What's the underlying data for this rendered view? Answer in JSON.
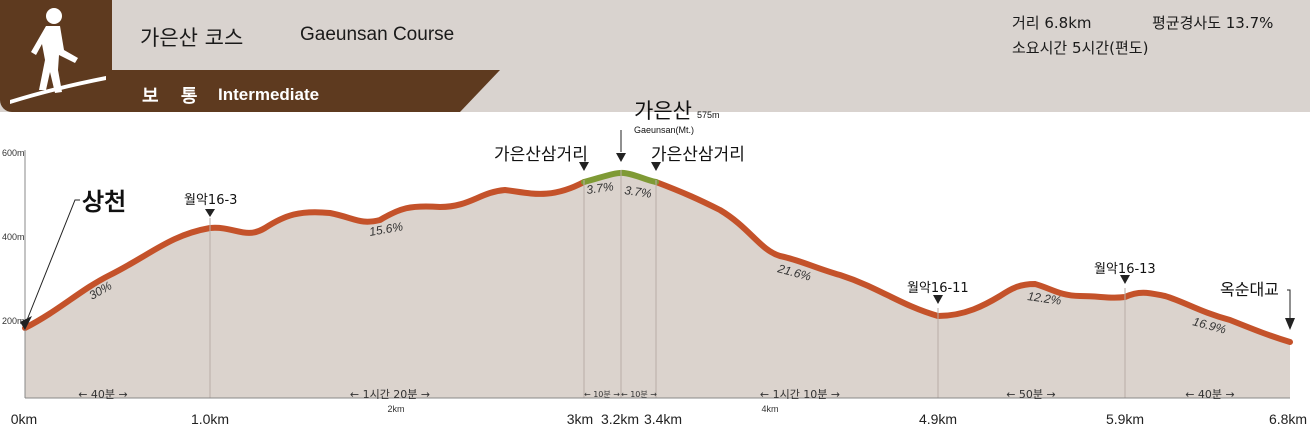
{
  "header": {
    "course_name_ko": "가은산 코스",
    "course_name_en": "Gaeunsan Course",
    "distance": "거리 6.8km",
    "avg_slope": "평균경사도 13.7%",
    "duration": "소요시간 5시간(편도)",
    "difficulty_ko": "보 통",
    "difficulty_en": "Intermediate",
    "icon": "hiker-icon"
  },
  "colors": {
    "brown": "#5e3a1f",
    "trail": "#c4522a",
    "summit_trail": "#7f9a35",
    "area_fill": "#dbd3cd",
    "header_bg": "#d9d3cf"
  },
  "y_axis": {
    "ticks": [
      "200m",
      "400m",
      "600m"
    ]
  },
  "x_axis": {
    "ticks": [
      "0km",
      "1.0km",
      "3km",
      "3.2km",
      "3.4km",
      "4.9km",
      "5.9km",
      "6.8km"
    ],
    "minor_ticks": [
      "2km",
      "4km"
    ]
  },
  "places": {
    "start": "상천",
    "wol16_3": "월악16-3",
    "junction_left": "가은산삼거리",
    "summit": "가은산",
    "summit_height": "575m",
    "summit_en": "Gaeunsan(Mt.)",
    "junction_right": "가은산삼거리",
    "wol16_11": "월악16-11",
    "wol16_13": "월악16-13",
    "end": "옥순대교"
  },
  "slopes": [
    "30%",
    "15.6%",
    "3.7%",
    "3.7%",
    "21.6%",
    "12.2%",
    "16.9%"
  ],
  "durations": [
    "← 40분 →",
    "← 1시간 20분 →",
    "← 10분 →",
    "← 10분 →",
    "← 1시간 10분 →",
    "← 50분 →",
    "← 40분 →"
  ]
}
